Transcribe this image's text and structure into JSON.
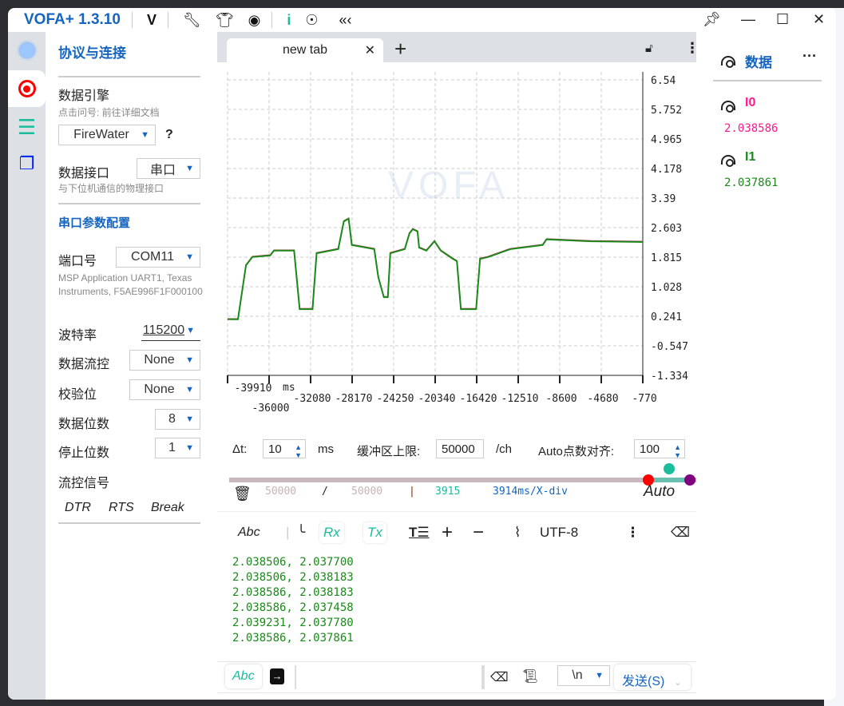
{
  "app": {
    "title": "VOFA+ 1.3.10"
  },
  "left": {
    "title": "协议与连接",
    "engine_label": "数据引擎",
    "engine_hint": "点击问号: 前往详细文档",
    "engine_value": "FireWater",
    "help": "?",
    "iface_label": "数据接口",
    "iface_value": "串口",
    "iface_hint": "与下位机通信的物理接口",
    "serial_title": "串口参数配置",
    "port_label": "端口号",
    "port_value": "COM11",
    "port_desc": "MSP Application UART1, Texas Instruments, F5AE996F1F000100",
    "baud_label": "波特率",
    "baud_value": "115200",
    "flow_label": "数据流控",
    "flow_value": "None",
    "parity_label": "校验位",
    "parity_value": "None",
    "databits_label": "数据位数",
    "databits_value": "8",
    "stopbits_label": "停止位数",
    "stopbits_value": "1",
    "signals_label": "流控信号",
    "signals": [
      "DTR",
      "RTS",
      "Break"
    ]
  },
  "tabs": [
    {
      "label": "new tab"
    }
  ],
  "chart_data": {
    "type": "line",
    "xlabel": "ms",
    "xlim": [
      -39910,
      -770
    ],
    "ylim": [
      -1.334,
      6.54
    ],
    "grid": true,
    "x_ticks": [
      "-39910",
      "-36000",
      "-32080",
      "-28170",
      "-24250",
      "-20340",
      "-16420",
      "-12510",
      "-8600",
      "-4680",
      "-770"
    ],
    "y_ticks": [
      "6.54",
      "5.752",
      "4.965",
      "4.178",
      "3.39",
      "2.603",
      "1.815",
      "1.028",
      "0.241",
      "-0.547",
      "-1.334"
    ],
    "watermark": "VOFA",
    "series": [
      {
        "name": "I0",
        "color": "#e0115f",
        "points": [
          [
            -39910,
            0.16
          ],
          [
            -38930,
            0.16
          ],
          [
            -38170,
            1.6
          ],
          [
            -37570,
            1.82
          ],
          [
            -35900,
            1.86
          ],
          [
            -35530,
            1.99
          ],
          [
            -33640,
            1.99
          ],
          [
            -33110,
            0.43
          ],
          [
            -31900,
            0.43
          ],
          [
            -31520,
            1.92
          ],
          [
            -29480,
            2.03
          ],
          [
            -28950,
            2.77
          ],
          [
            -28500,
            2.84
          ],
          [
            -28200,
            2.14
          ],
          [
            -26080,
            2.03
          ],
          [
            -25700,
            1.28
          ],
          [
            -25180,
            0.75
          ],
          [
            -24800,
            0.75
          ],
          [
            -24570,
            1.92
          ],
          [
            -23210,
            2.03
          ],
          [
            -22760,
            2.45
          ],
          [
            -22450,
            2.56
          ],
          [
            -22000,
            2.5
          ],
          [
            -21850,
            2.07
          ],
          [
            -21170,
            1.99
          ],
          [
            -20410,
            2.24
          ],
          [
            -19810,
            1.99
          ],
          [
            -18670,
            1.77
          ],
          [
            -18290,
            1.71
          ],
          [
            -17920,
            0.43
          ],
          [
            -16480,
            0.43
          ],
          [
            -16110,
            1.77
          ],
          [
            -15350,
            1.82
          ],
          [
            -13240,
            2.03
          ],
          [
            -10210,
            2.14
          ],
          [
            -9840,
            2.29
          ],
          [
            -5680,
            2.24
          ],
          [
            -770,
            2.22
          ]
        ]
      },
      {
        "name": "I1",
        "color": "#1a8a1a",
        "points": [
          [
            -39910,
            0.16
          ],
          [
            -38930,
            0.16
          ],
          [
            -38170,
            1.6
          ],
          [
            -37570,
            1.82
          ],
          [
            -35900,
            1.86
          ],
          [
            -35530,
            1.99
          ],
          [
            -33640,
            1.99
          ],
          [
            -33110,
            0.43
          ],
          [
            -31900,
            0.43
          ],
          [
            -31520,
            1.92
          ],
          [
            -29480,
            2.03
          ],
          [
            -28950,
            2.77
          ],
          [
            -28500,
            2.84
          ],
          [
            -28200,
            2.14
          ],
          [
            -26080,
            2.03
          ],
          [
            -25700,
            1.28
          ],
          [
            -25180,
            0.75
          ],
          [
            -24800,
            0.75
          ],
          [
            -24570,
            1.92
          ],
          [
            -23210,
            2.03
          ],
          [
            -22760,
            2.45
          ],
          [
            -22450,
            2.56
          ],
          [
            -22000,
            2.5
          ],
          [
            -21850,
            2.07
          ],
          [
            -21170,
            1.99
          ],
          [
            -20410,
            2.24
          ],
          [
            -19810,
            1.99
          ],
          [
            -18670,
            1.77
          ],
          [
            -18290,
            1.71
          ],
          [
            -17920,
            0.43
          ],
          [
            -16480,
            0.43
          ],
          [
            -16110,
            1.77
          ],
          [
            -15350,
            1.82
          ],
          [
            -13240,
            2.03
          ],
          [
            -10210,
            2.14
          ],
          [
            -9840,
            2.29
          ],
          [
            -5680,
            2.24
          ],
          [
            -770,
            2.22
          ]
        ]
      }
    ]
  },
  "controls": {
    "dt_label": "Δt:",
    "dt_value": "10",
    "dt_unit": "ms",
    "buf_label": "缓冲区上限:",
    "buf_value": "50000",
    "buf_unit": "/ch",
    "auto_label": "Auto点数对齐:",
    "auto_value": "100"
  },
  "status": {
    "count": "50000",
    "slash": "/",
    "total": "50000",
    "bar": "|",
    "points": "3915",
    "div": "3914ms/X-div",
    "auto": "Auto"
  },
  "toolbar": {
    "abc": "Abc",
    "rx": "Rx",
    "tx": "Tx",
    "encoding": "UTF-8"
  },
  "log": [
    "2.038506, 2.037700",
    "2.038506, 2.038183",
    "2.038586, 2.038183",
    "2.038586, 2.037458",
    "2.039231, 2.037780",
    "2.038586, 2.037861"
  ],
  "send": {
    "abc": "Abc",
    "newline": "\\n",
    "send_label": "发送(S)"
  },
  "right": {
    "title": "数据",
    "channels": [
      {
        "name": "I0",
        "value": "2.038586",
        "color": "#ff1a8c"
      },
      {
        "name": "I1",
        "value": "2.037861",
        "color": "#1a8a1a"
      }
    ]
  }
}
